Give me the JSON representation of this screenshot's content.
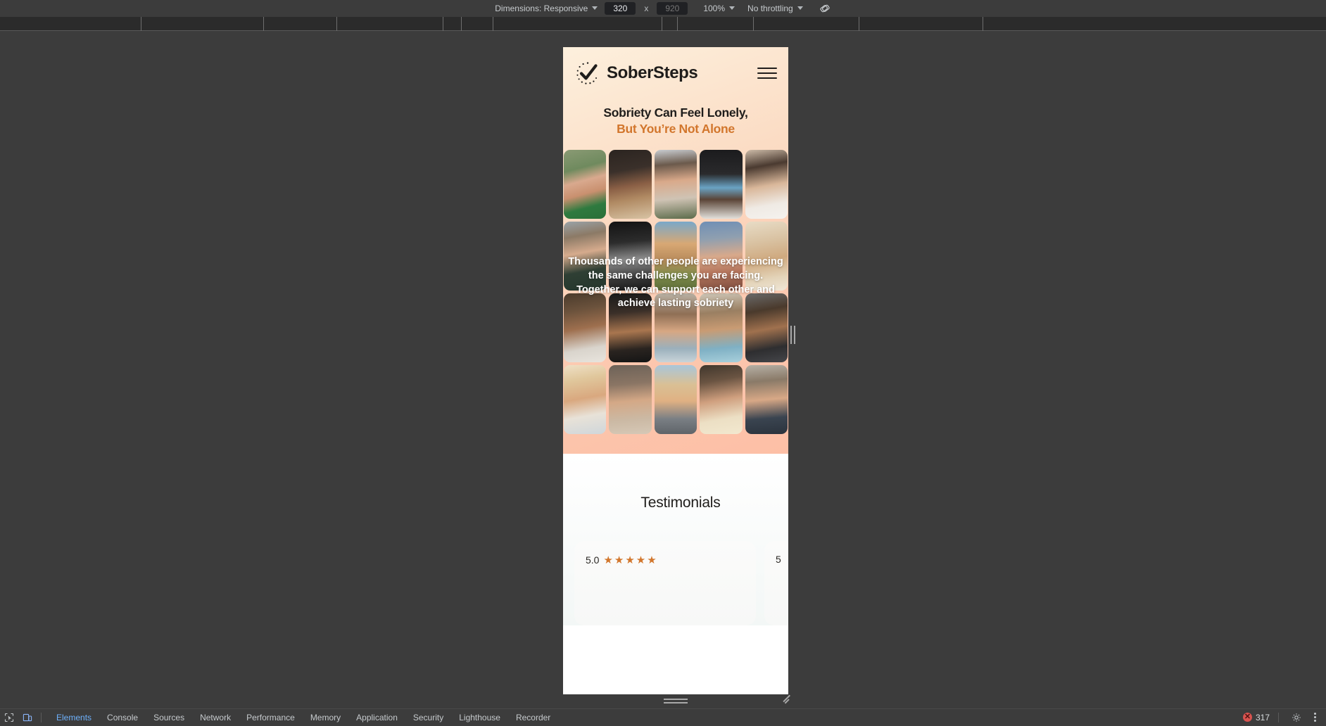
{
  "device_toolbar": {
    "dimensions_label": "Dimensions: Responsive",
    "width_value": "320",
    "height_placeholder": "920",
    "multiply_symbol": "x",
    "zoom_label": "100%",
    "throttling_label": "No throttling",
    "rotate_icon": "rotate-device-icon"
  },
  "page": {
    "brand": "SoberSteps",
    "logo_icon": "checkmark-circle-icon",
    "menu_icon": "hamburger-menu-icon",
    "headline_line1": "Sobriety Can Feel Lonely,",
    "headline_line2": "But You’re Not Alone",
    "overlay_text": "Thousands of other people are experiencing the same challenges you are facing. Together, we can support each other and achieve lasting sobriety",
    "accent_color": "#d2762c",
    "testimonials": {
      "title": "Testimonials",
      "cards": [
        {
          "rating": "5.0",
          "stars": "★★★★★"
        },
        {
          "rating": "5",
          "stars": ""
        }
      ]
    }
  },
  "devtools_bar": {
    "inspect_icon": "inspect-element-icon",
    "device_toggle_icon": "device-toolbar-icon",
    "tabs": [
      {
        "label": "Elements",
        "active": true
      },
      {
        "label": "Console",
        "active": false
      },
      {
        "label": "Sources",
        "active": false
      },
      {
        "label": "Network",
        "active": false
      },
      {
        "label": "Performance",
        "active": false
      },
      {
        "label": "Memory",
        "active": false
      },
      {
        "label": "Application",
        "active": false
      },
      {
        "label": "Security",
        "active": false
      },
      {
        "label": "Lighthouse",
        "active": false
      },
      {
        "label": "Recorder",
        "active": false
      }
    ],
    "error_icon": "error-badge-icon",
    "error_count": "317",
    "settings_icon": "gear-icon",
    "more_icon": "kebab-menu-icon"
  }
}
